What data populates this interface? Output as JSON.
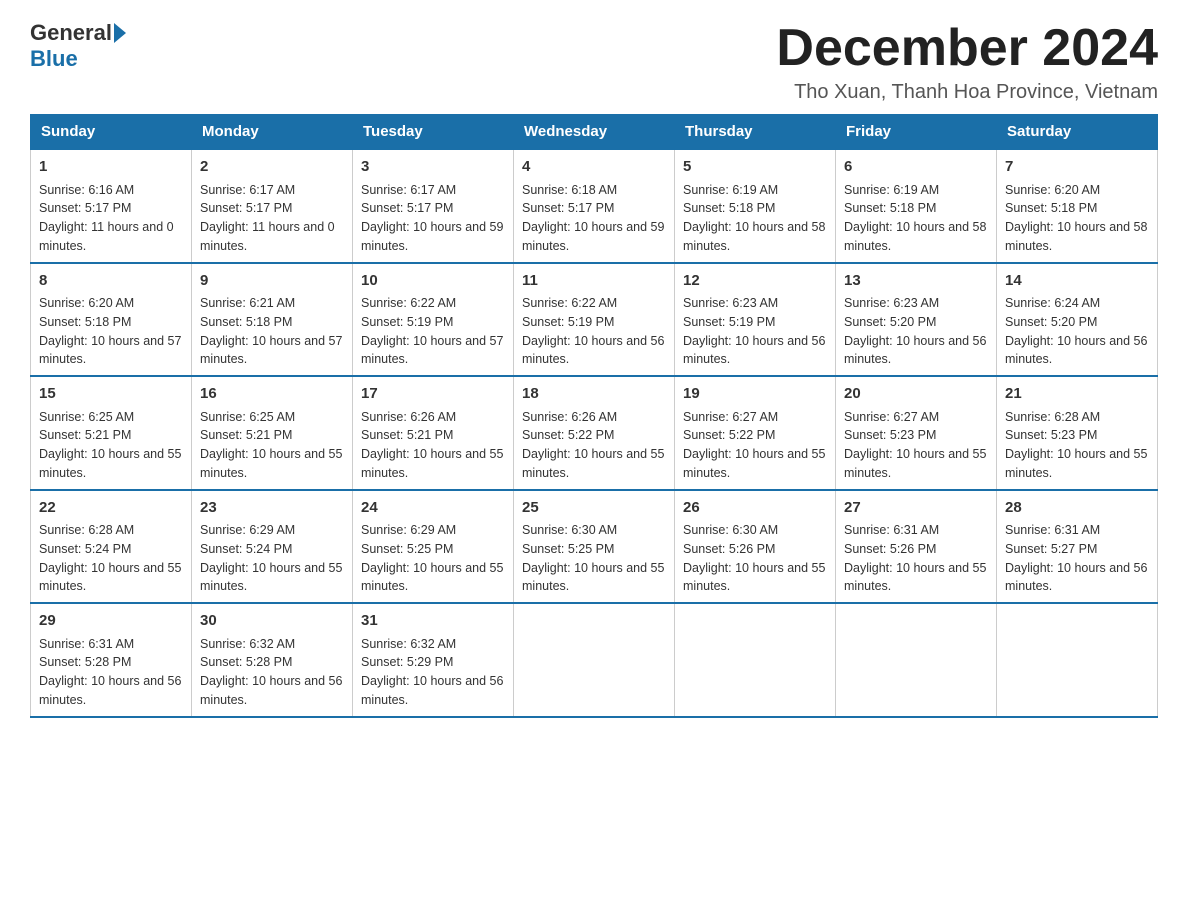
{
  "header": {
    "logo_general": "General",
    "logo_blue": "Blue",
    "month_year": "December 2024",
    "location": "Tho Xuan, Thanh Hoa Province, Vietnam"
  },
  "days_of_week": [
    "Sunday",
    "Monday",
    "Tuesday",
    "Wednesday",
    "Thursday",
    "Friday",
    "Saturday"
  ],
  "weeks": [
    [
      {
        "day": "1",
        "sunrise": "6:16 AM",
        "sunset": "5:17 PM",
        "daylight": "11 hours and 0 minutes."
      },
      {
        "day": "2",
        "sunrise": "6:17 AM",
        "sunset": "5:17 PM",
        "daylight": "11 hours and 0 minutes."
      },
      {
        "day": "3",
        "sunrise": "6:17 AM",
        "sunset": "5:17 PM",
        "daylight": "10 hours and 59 minutes."
      },
      {
        "day": "4",
        "sunrise": "6:18 AM",
        "sunset": "5:17 PM",
        "daylight": "10 hours and 59 minutes."
      },
      {
        "day": "5",
        "sunrise": "6:19 AM",
        "sunset": "5:18 PM",
        "daylight": "10 hours and 58 minutes."
      },
      {
        "day": "6",
        "sunrise": "6:19 AM",
        "sunset": "5:18 PM",
        "daylight": "10 hours and 58 minutes."
      },
      {
        "day": "7",
        "sunrise": "6:20 AM",
        "sunset": "5:18 PM",
        "daylight": "10 hours and 58 minutes."
      }
    ],
    [
      {
        "day": "8",
        "sunrise": "6:20 AM",
        "sunset": "5:18 PM",
        "daylight": "10 hours and 57 minutes."
      },
      {
        "day": "9",
        "sunrise": "6:21 AM",
        "sunset": "5:18 PM",
        "daylight": "10 hours and 57 minutes."
      },
      {
        "day": "10",
        "sunrise": "6:22 AM",
        "sunset": "5:19 PM",
        "daylight": "10 hours and 57 minutes."
      },
      {
        "day": "11",
        "sunrise": "6:22 AM",
        "sunset": "5:19 PM",
        "daylight": "10 hours and 56 minutes."
      },
      {
        "day": "12",
        "sunrise": "6:23 AM",
        "sunset": "5:19 PM",
        "daylight": "10 hours and 56 minutes."
      },
      {
        "day": "13",
        "sunrise": "6:23 AM",
        "sunset": "5:20 PM",
        "daylight": "10 hours and 56 minutes."
      },
      {
        "day": "14",
        "sunrise": "6:24 AM",
        "sunset": "5:20 PM",
        "daylight": "10 hours and 56 minutes."
      }
    ],
    [
      {
        "day": "15",
        "sunrise": "6:25 AM",
        "sunset": "5:21 PM",
        "daylight": "10 hours and 55 minutes."
      },
      {
        "day": "16",
        "sunrise": "6:25 AM",
        "sunset": "5:21 PM",
        "daylight": "10 hours and 55 minutes."
      },
      {
        "day": "17",
        "sunrise": "6:26 AM",
        "sunset": "5:21 PM",
        "daylight": "10 hours and 55 minutes."
      },
      {
        "day": "18",
        "sunrise": "6:26 AM",
        "sunset": "5:22 PM",
        "daylight": "10 hours and 55 minutes."
      },
      {
        "day": "19",
        "sunrise": "6:27 AM",
        "sunset": "5:22 PM",
        "daylight": "10 hours and 55 minutes."
      },
      {
        "day": "20",
        "sunrise": "6:27 AM",
        "sunset": "5:23 PM",
        "daylight": "10 hours and 55 minutes."
      },
      {
        "day": "21",
        "sunrise": "6:28 AM",
        "sunset": "5:23 PM",
        "daylight": "10 hours and 55 minutes."
      }
    ],
    [
      {
        "day": "22",
        "sunrise": "6:28 AM",
        "sunset": "5:24 PM",
        "daylight": "10 hours and 55 minutes."
      },
      {
        "day": "23",
        "sunrise": "6:29 AM",
        "sunset": "5:24 PM",
        "daylight": "10 hours and 55 minutes."
      },
      {
        "day": "24",
        "sunrise": "6:29 AM",
        "sunset": "5:25 PM",
        "daylight": "10 hours and 55 minutes."
      },
      {
        "day": "25",
        "sunrise": "6:30 AM",
        "sunset": "5:25 PM",
        "daylight": "10 hours and 55 minutes."
      },
      {
        "day": "26",
        "sunrise": "6:30 AM",
        "sunset": "5:26 PM",
        "daylight": "10 hours and 55 minutes."
      },
      {
        "day": "27",
        "sunrise": "6:31 AM",
        "sunset": "5:26 PM",
        "daylight": "10 hours and 55 minutes."
      },
      {
        "day": "28",
        "sunrise": "6:31 AM",
        "sunset": "5:27 PM",
        "daylight": "10 hours and 56 minutes."
      }
    ],
    [
      {
        "day": "29",
        "sunrise": "6:31 AM",
        "sunset": "5:28 PM",
        "daylight": "10 hours and 56 minutes."
      },
      {
        "day": "30",
        "sunrise": "6:32 AM",
        "sunset": "5:28 PM",
        "daylight": "10 hours and 56 minutes."
      },
      {
        "day": "31",
        "sunrise": "6:32 AM",
        "sunset": "5:29 PM",
        "daylight": "10 hours and 56 minutes."
      },
      null,
      null,
      null,
      null
    ]
  ]
}
